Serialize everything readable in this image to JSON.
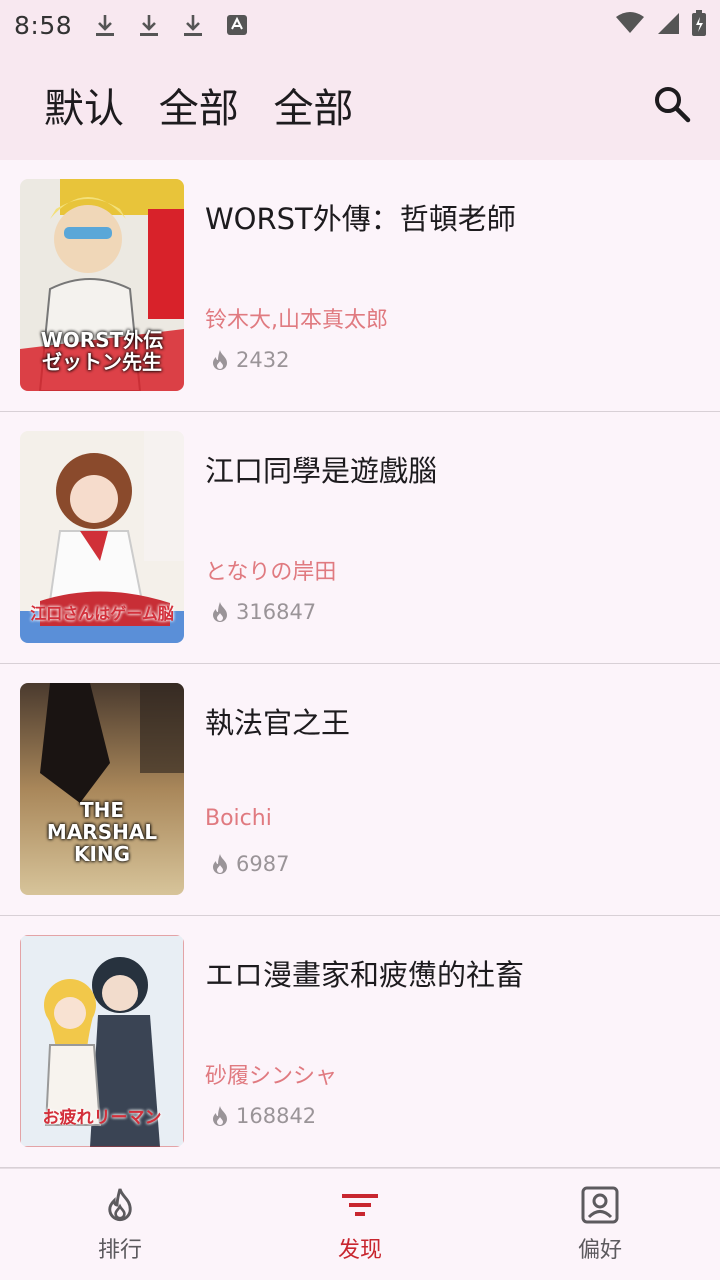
{
  "status": {
    "time": "8:58"
  },
  "app_bar": {
    "title_parts": [
      "默认",
      "全部",
      "全部"
    ]
  },
  "items": [
    {
      "title": "WORST外傳：哲頓老師",
      "author": "铃木大,山本真太郎",
      "views": "2432",
      "cover_text": "WORST外伝 ゼットン先生"
    },
    {
      "title": "江口同學是遊戲腦",
      "author": "となりの岸田",
      "views": "316847",
      "cover_text": "江口さんはゲーム脳"
    },
    {
      "title": "執法官之王",
      "author": "Boichi",
      "views": "6987",
      "cover_text": "THE MARSHAL KING"
    },
    {
      "title": "エロ漫畫家和疲憊的社畜",
      "author": "砂履シンシャ",
      "views": "168842",
      "cover_text": "お疲れリーマン"
    }
  ],
  "nav": [
    {
      "label": "排行",
      "icon": "fire-icon"
    },
    {
      "label": "发现",
      "icon": "filter-icon"
    },
    {
      "label": "偏好",
      "icon": "account-box-icon"
    }
  ],
  "colors": {
    "accent": "#c8262f",
    "author": "#e07a80",
    "bar_bg": "#f8e8f0",
    "page_bg": "#fcf4fa"
  }
}
